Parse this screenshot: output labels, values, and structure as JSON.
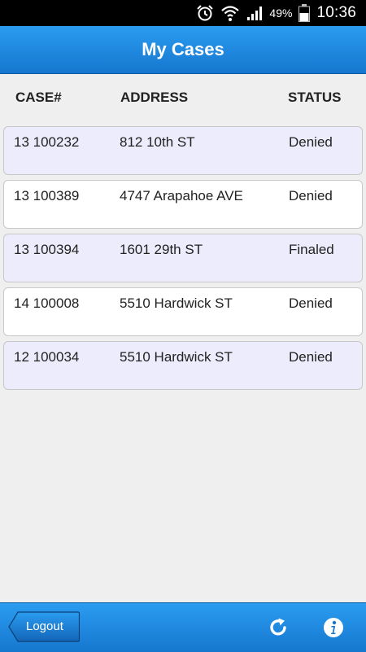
{
  "status_bar": {
    "battery_pct": "49%",
    "time": "10:36",
    "icons": [
      "alarm-icon",
      "wifi-icon",
      "signal-icon",
      "battery-icon"
    ]
  },
  "header": {
    "title": "My Cases"
  },
  "columns": {
    "case": "CASE#",
    "address": "ADDRESS",
    "status": "STATUS"
  },
  "cases": [
    {
      "case": "13 100232",
      "address": "812 10th ST",
      "status": "Denied"
    },
    {
      "case": "13 100389",
      "address": "4747 Arapahoe AVE",
      "status": "Denied"
    },
    {
      "case": "13 100394",
      "address": "1601 29th ST",
      "status": "Finaled"
    },
    {
      "case": "14 100008",
      "address": "5510 Hardwick ST",
      "status": "Denied"
    },
    {
      "case": "12 100034",
      "address": "5510 Hardwick ST",
      "status": "Denied"
    }
  ],
  "footer": {
    "logout_label": "Logout",
    "icons": [
      "refresh-icon",
      "info-icon"
    ]
  },
  "colors": {
    "header_blue": "#1a86dc",
    "row_alt": "#ececfc",
    "row_plain": "#ffffff",
    "background": "#efefef"
  }
}
